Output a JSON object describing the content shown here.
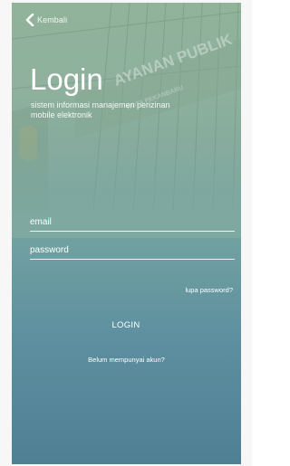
{
  "header": {
    "back_label": "Kembali"
  },
  "login": {
    "title": "Login",
    "subtitle": "sistem informasi manajemen perizinan mobile elektronik",
    "email_placeholder": "email",
    "password_placeholder": "password",
    "forgot_label": "lupa password?",
    "button_label": "LOGIN",
    "register_label": "Belum mempunyai akun?"
  },
  "background": {
    "photo_sign_text": "AYANAN PUBLIK",
    "photo_sub_text": "KOTA PEKANBARU"
  },
  "colors": {
    "gradient_top": "#90b39a",
    "gradient_bottom": "#4f7f94",
    "text": "#ffffff"
  },
  "icons": {
    "back": "chevron-left-icon"
  }
}
